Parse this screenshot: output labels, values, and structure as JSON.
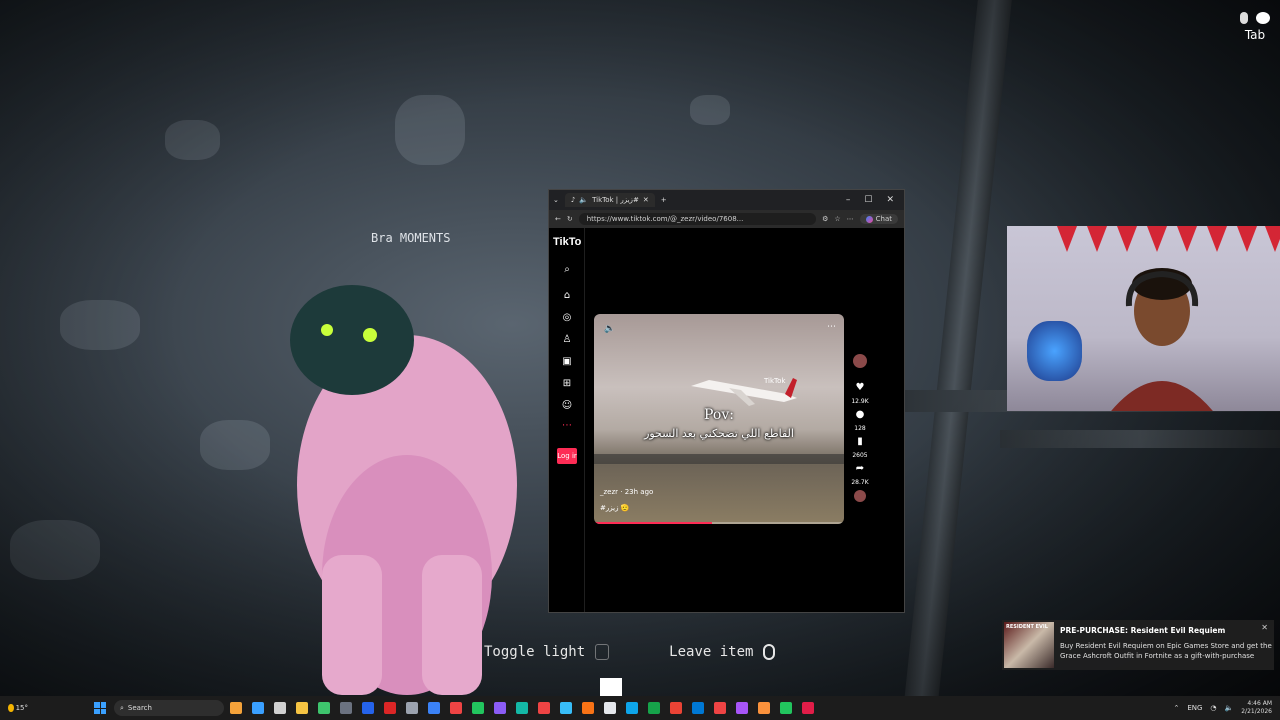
{
  "game": {
    "player_name": "Bra MOMENTS",
    "hints": {
      "toggle_light": "Toggle light",
      "leave_item": "Leave item"
    },
    "top_right_label": "Tab"
  },
  "browser": {
    "tab_title": "TikTok | زيزر#",
    "url": "https://www.tiktok.com/@_zezr/video/7608...",
    "chat_label": "Chat"
  },
  "tiktok": {
    "logo_text": "TikTo",
    "login_label": "Log ir",
    "video": {
      "title": "Pov:",
      "caption": "القاطع اللي تضحكني بعد السحور",
      "user_line": "_zezr · 23h ago",
      "hashtag": "#زيزر 🫡",
      "progress": 0.47,
      "watermark": "TikTok"
    },
    "actions": {
      "likes": "12.9K",
      "comments": "128",
      "saves": "2605",
      "shares": "28.7K"
    }
  },
  "notification": {
    "thumb_text": "RESIDENT EVIL",
    "title": "PRE-PURCHASE: Resident Evil Requiem",
    "body": "Buy Resident Evil Requiem on Epic Games Store and get the Grace Ashcroft Outfit in Fortnite as a gift-with-purchase"
  },
  "taskbar": {
    "temp": "15°",
    "search_placeholder": "Search",
    "lang": "ENG",
    "time": "4:46 AM",
    "date": "2/21/2026"
  }
}
